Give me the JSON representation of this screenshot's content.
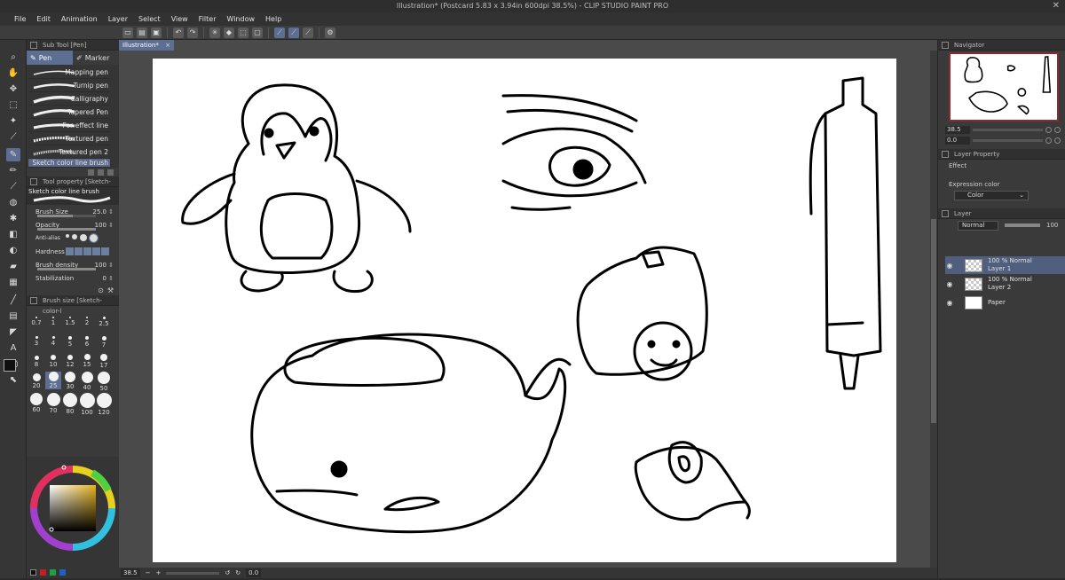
{
  "window": {
    "title": "Illustration* (Postcard 5.83 x 3.94in 600dpi 38.5%)  - CLIP STUDIO PAINT PRO"
  },
  "menu": [
    "File",
    "Edit",
    "Animation",
    "Layer",
    "Select",
    "View",
    "Filter",
    "Window",
    "Help"
  ],
  "subtool": {
    "panel_title": "Sub Tool [Pen]",
    "tabs": [
      "Pen",
      "Marker"
    ],
    "brushes": [
      "Mapping pen",
      "Turnip pen",
      "Calligraphy",
      "Tapered Pen",
      "For effect line",
      "Textured pen",
      "Textured pen 2",
      "Sketch color line brush"
    ]
  },
  "tool_property": {
    "panel_title": "Tool property [Sketch-color-",
    "brush_name": "Sketch color line brush",
    "brush_size_label": "Brush Size",
    "brush_size_value": "25.0",
    "opacity_label": "Opacity",
    "opacity_value": "100",
    "antialias_label": "Anti-alias",
    "hardness_label": "Hardness",
    "density_label": "Brush density",
    "density_value": "100",
    "stabilization_label": "Stabilization",
    "stabilization_value": "0"
  },
  "brush_size": {
    "panel_title": "Brush size [Sketch-color-l",
    "sizes": [
      "0.7",
      "1",
      "1.5",
      "2",
      "2.5",
      "3",
      "4",
      "5",
      "6",
      "7",
      "8",
      "10",
      "12",
      "15",
      "17",
      "20",
      "25",
      "30",
      "40",
      "50",
      "60",
      "70",
      "80",
      "100",
      "120"
    ]
  },
  "document": {
    "tab_label": "Illustration*",
    "tab_close": "×"
  },
  "status": {
    "zoom": "38.5",
    "rotation": "0.0"
  },
  "navigator": {
    "panel_title": "Navigator",
    "zoom": "38.5",
    "rotation": "0.0"
  },
  "layer_property": {
    "panel_title": "Layer Property",
    "effect_label": "Effect",
    "expression_color_label": "Expression color",
    "expression_color_value": "Color"
  },
  "layers": {
    "panel_title": "Layer",
    "blend_mode": "Normal",
    "opacity": "100",
    "items": [
      {
        "line1": "100 % Normal",
        "line2": "Layer 1",
        "selected": true
      },
      {
        "line1": "100 % Normal",
        "line2": "Layer 2",
        "selected": false
      },
      {
        "line1": "",
        "line2": "Paper",
        "selected": false
      }
    ]
  },
  "colors": {
    "accent": "#5c6f93",
    "main_color": "#0f0f0f",
    "sub_color": "#e8a53c"
  },
  "icons": [
    "pen-icon",
    "marker-icon",
    "eye-icon",
    "hand-icon",
    "zoom-icon",
    "move-icon",
    "undo-icon",
    "redo-icon"
  ]
}
